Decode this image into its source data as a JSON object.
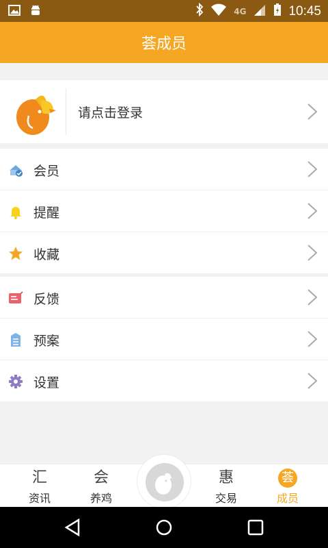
{
  "status_bar": {
    "time": "10:45",
    "network_label": "4G",
    "icons": [
      "image-icon",
      "android-icon",
      "bluetooth-icon",
      "wifi-icon",
      "signal-icon",
      "battery-icon"
    ]
  },
  "header": {
    "title": "荟成员"
  },
  "profile": {
    "login_text": "请点击登录"
  },
  "menu_group1": [
    {
      "label": "会员",
      "icon": "member-icon"
    },
    {
      "label": "提醒",
      "icon": "bell-icon"
    },
    {
      "label": "收藏",
      "icon": "star-icon"
    }
  ],
  "menu_group2": [
    {
      "label": "反馈",
      "icon": "feedback-icon"
    },
    {
      "label": "预案",
      "icon": "document-icon"
    },
    {
      "label": "设置",
      "icon": "gear-icon"
    }
  ],
  "tabbar": {
    "tabs": [
      {
        "label": "资讯",
        "glyph": "汇"
      },
      {
        "label": "养鸡",
        "glyph": "会"
      },
      {
        "label": "交易",
        "glyph": "惠"
      },
      {
        "label": "成员",
        "glyph": "荟",
        "active": true
      }
    ]
  },
  "colors": {
    "accent": "#f5a623",
    "status_bar": "#8a5a12"
  }
}
